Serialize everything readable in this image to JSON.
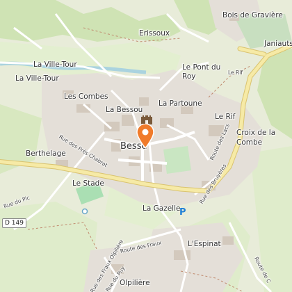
{
  "map": {
    "labels": {
      "bois_de_graviere": "Bois de Gravière",
      "janiauts": "Janiauts",
      "erissoux": "Erissoux",
      "la_ville_tour_1": "La Ville-Tour",
      "la_ville_tour_2": "La Ville-Tour",
      "le_pont_du_roy": "Le Pont du Roy",
      "le_rif_1": "Le Rif",
      "le_rif_2": "Le Rif",
      "les_combes": "Les Combes",
      "la_bessou": "La Bessou",
      "la_partoune": "La Partoune",
      "besse": "Besse",
      "croix_de_la_combe": "Croix de la Combe",
      "berthelage": "Berthelage",
      "le_stade": "Le Stade",
      "la_gazelle": "La Gazelle",
      "l_espinat": "L'Espinat",
      "olpiliere": "Olpilière"
    },
    "streets": {
      "rue_des_pres_chabrat": "Rue des Prés Chabrat",
      "route_des_lacs": "Route des Lacs",
      "rue_des_bruyeres": "Rue des Bruyères",
      "rue_du_pic": "Rue du Pic",
      "route_des_fraux": "Route des Fraux",
      "rue_des_fraux_olpiliere": "Rue des Fraux Olpilière",
      "rue_du_puy": "Rue du Puy",
      "route_de_c": "Route de C"
    },
    "road_badge": "D 149",
    "parking": "P",
    "marker_icon": "location-pin-icon",
    "castle_icon": "castle-icon",
    "colors": {
      "background": "#f2efe9",
      "forest": "#cfe3b4",
      "meadow": "#e3efd0",
      "residential": "#e4dfd8",
      "buildings": "#d3c9bd",
      "main_road": "#f6eaa6",
      "water": "#aad3df",
      "marker": "#f07b2b",
      "pitch": "#aadfb3"
    }
  }
}
